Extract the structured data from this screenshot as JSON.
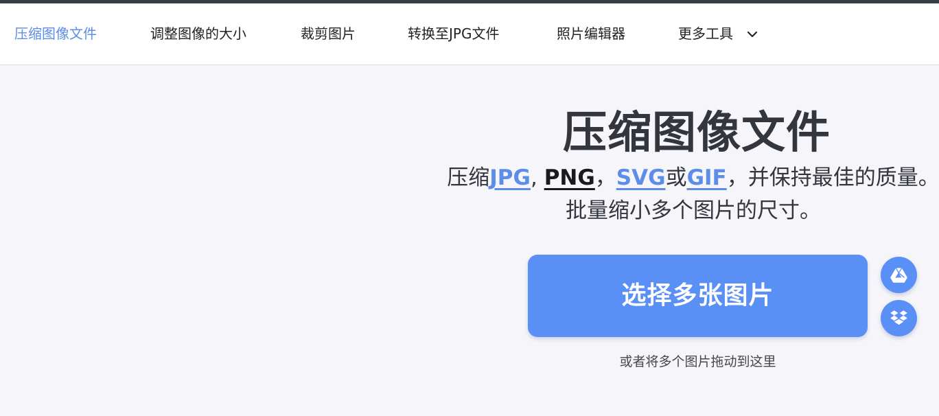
{
  "nav": {
    "items": [
      {
        "label": "压缩图像文件",
        "active": true
      },
      {
        "label": "调整图像的大小",
        "active": false
      },
      {
        "label": "裁剪图片",
        "active": false
      },
      {
        "label": "转换至JPG文件",
        "active": false
      },
      {
        "label": "照片编辑器",
        "active": false
      },
      {
        "label": "更多工具",
        "active": false,
        "icon": "chevron-down-icon"
      }
    ]
  },
  "hero": {
    "title": "压缩图像文件",
    "subtitle": {
      "prefix": "压缩",
      "formats": [
        "JPG",
        "PNG",
        "SVG",
        "GIF"
      ],
      "sep1": ", ",
      "sep2": "，",
      "or": "或",
      "suffix": "，并保持最佳的质量。",
      "line2": "批量缩小多个图片的尺寸。"
    },
    "select_button": "选择多张图片",
    "drop_hint": "或者将多个图片拖动到这里",
    "cloud_buttons": [
      {
        "icon": "google-drive-icon"
      },
      {
        "icon": "dropbox-icon"
      }
    ]
  },
  "colors": {
    "accent": "#5a8ff5",
    "active_nav": "#5c8de9",
    "text": "#33363d",
    "background": "#f5f5fa",
    "topbar": "#383e45"
  }
}
